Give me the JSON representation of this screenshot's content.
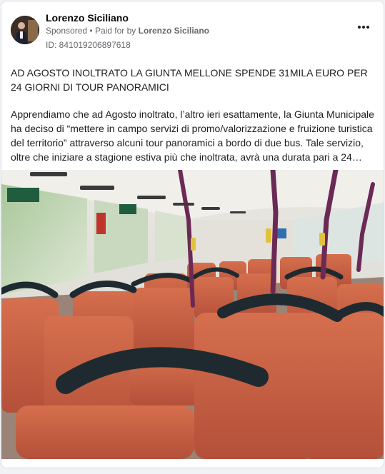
{
  "post": {
    "author": "Lorenzo Siciliano",
    "sponsored_label": "Sponsored",
    "paid_for_prefix": "Paid for by",
    "paid_for_name": "Lorenzo Siciliano",
    "ad_id": "ID: 841019206897618",
    "headline": "AD AGOSTO INOLTRATO LA GIUNTA MELLONE SPENDE 31MILA EURO PER 24 GIORNI DI TOUR PANORAMICI",
    "description": "Apprendiamo che ad Agosto inoltrato, l’altro ieri esattamente, la Giunta Municipale ha deciso di “mettere in campo servizi di promo/valorizzazione e fruizione turistica del territorio” attraverso alcuni tour panoramici a bordo di due bus. Tale servizio, oltre che iniziare a stagione estiva più che inoltrata, avrà una durata pari a 24…",
    "separator": "•"
  },
  "icons": {
    "more": "more-options-icon"
  },
  "colors": {
    "text_primary": "#050505",
    "text_secondary": "#65676b",
    "seat_orange": "#c8603f",
    "pole_purple": "#6b2a55"
  }
}
